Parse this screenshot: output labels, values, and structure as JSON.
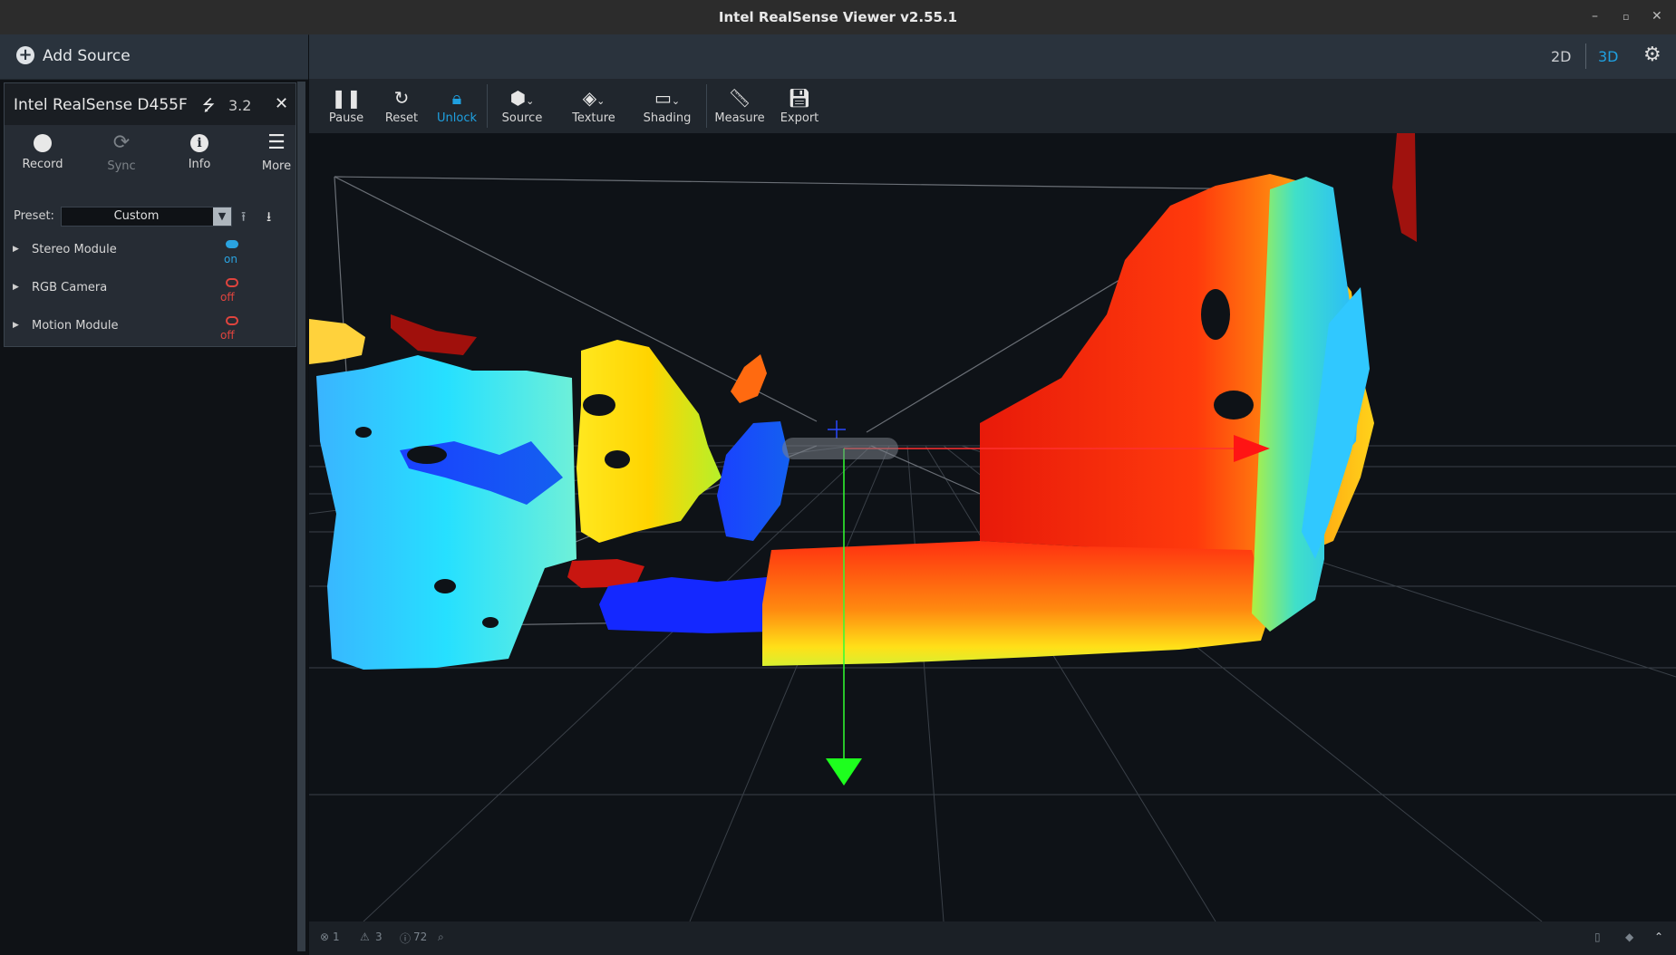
{
  "window": {
    "title": "Intel RealSense Viewer v2.55.1"
  },
  "add_source": {
    "label": "Add Source"
  },
  "device": {
    "name": "Intel RealSense D455F",
    "usb_version": "3.2",
    "actions": [
      {
        "label": "Record",
        "icon": "record-icon"
      },
      {
        "label": "Sync",
        "icon": "sync-icon"
      },
      {
        "label": "Info",
        "icon": "info-icon"
      },
      {
        "label": "More",
        "icon": "menu-icon"
      }
    ],
    "preset": {
      "label": "Preset:",
      "value": "Custom"
    },
    "modules": [
      {
        "name": "Stereo Module",
        "state": "on"
      },
      {
        "name": "RGB Camera",
        "state": "off"
      },
      {
        "name": "Motion Module",
        "state": "off"
      }
    ]
  },
  "view_modes": {
    "two_d": "2D",
    "three_d": "3D",
    "active": "3D"
  },
  "toolbar": {
    "pause": "Pause",
    "reset": "Reset",
    "unlock": "Unlock",
    "source": "Source",
    "texture": "Texture",
    "shading": "Shading",
    "measure": "Measure",
    "export": "Export"
  },
  "status": {
    "errors": "1",
    "warnings": "3",
    "info": "72"
  },
  "colors": {
    "accent": "#1fa0e0",
    "off": "#e0443e",
    "panel": "#2a333d"
  }
}
